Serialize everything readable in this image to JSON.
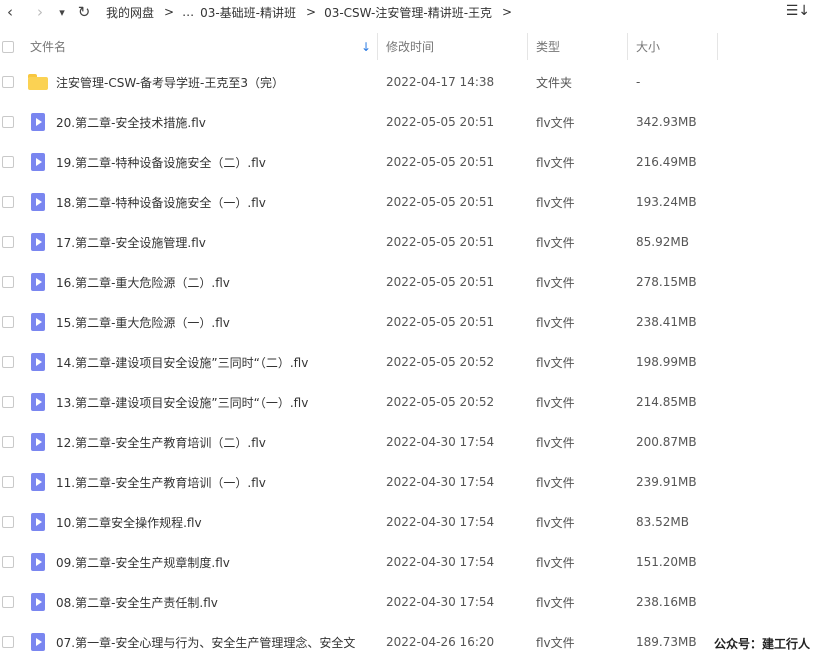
{
  "nav": {
    "back": "‹",
    "forward": "›",
    "dropdown": "▾",
    "refresh": "↻",
    "breadcrumbs": [
      "我的网盘",
      "…",
      "03-基础班-精讲班",
      "03-CSW-注安管理-精讲班-王克"
    ],
    "separator": ">",
    "sort_toggle": "☰↓"
  },
  "columns": {
    "name": "文件名",
    "modified": "修改时间",
    "type": "类型",
    "size": "大小",
    "sort_indicator": "↓"
  },
  "files": [
    {
      "name": "注安管理-CSW-备考导学班-王克至3（完）",
      "modified": "2022-04-17 14:38",
      "type": "文件夹",
      "size": "-",
      "icon": "folder-icon"
    },
    {
      "name": "20.第二章-安全技术措施.flv",
      "modified": "2022-05-05 20:51",
      "type": "flv文件",
      "size": "342.93MB",
      "icon": "video-file-icon"
    },
    {
      "name": "19.第二章-特种设备设施安全（二）.flv",
      "modified": "2022-05-05 20:51",
      "type": "flv文件",
      "size": "216.49MB",
      "icon": "video-file-icon"
    },
    {
      "name": "18.第二章-特种设备设施安全（一）.flv",
      "modified": "2022-05-05 20:51",
      "type": "flv文件",
      "size": "193.24MB",
      "icon": "video-file-icon"
    },
    {
      "name": "17.第二章-安全设施管理.flv",
      "modified": "2022-05-05 20:51",
      "type": "flv文件",
      "size": "85.92MB",
      "icon": "video-file-icon"
    },
    {
      "name": "16.第二章-重大危险源（二）.flv",
      "modified": "2022-05-05 20:51",
      "type": "flv文件",
      "size": "278.15MB",
      "icon": "video-file-icon"
    },
    {
      "name": "15.第二章-重大危险源（一）.flv",
      "modified": "2022-05-05 20:51",
      "type": "flv文件",
      "size": "238.41MB",
      "icon": "video-file-icon"
    },
    {
      "name": "14.第二章-建设项目安全设施”三同时“（二）.flv",
      "modified": "2022-05-05 20:52",
      "type": "flv文件",
      "size": "198.99MB",
      "icon": "video-file-icon"
    },
    {
      "name": "13.第二章-建设项目安全设施”三同时“（一）.flv",
      "modified": "2022-05-05 20:52",
      "type": "flv文件",
      "size": "214.85MB",
      "icon": "video-file-icon"
    },
    {
      "name": "12.第二章-安全生产教育培训（二）.flv",
      "modified": "2022-04-30 17:54",
      "type": "flv文件",
      "size": "200.87MB",
      "icon": "video-file-icon"
    },
    {
      "name": "11.第二章-安全生产教育培训（一）.flv",
      "modified": "2022-04-30 17:54",
      "type": "flv文件",
      "size": "239.91MB",
      "icon": "video-file-icon"
    },
    {
      "name": "10.第二章安全操作规程.flv",
      "modified": "2022-04-30 17:54",
      "type": "flv文件",
      "size": "83.52MB",
      "icon": "video-file-icon"
    },
    {
      "name": "09.第二章-安全生产规章制度.flv",
      "modified": "2022-04-30 17:54",
      "type": "flv文件",
      "size": "151.20MB",
      "icon": "video-file-icon"
    },
    {
      "name": "08.第二章-安全生产责任制.flv",
      "modified": "2022-04-30 17:54",
      "type": "flv文件",
      "size": "238.16MB",
      "icon": "video-file-icon"
    },
    {
      "name": "07.第一章-安全心理与行为、安全生产管理理念、安全文",
      "modified": "2022-04-26 16:20",
      "type": "flv文件",
      "size": "189.73MB",
      "icon": "video-file-icon"
    }
  ],
  "watermark": "公众号：建工行人"
}
